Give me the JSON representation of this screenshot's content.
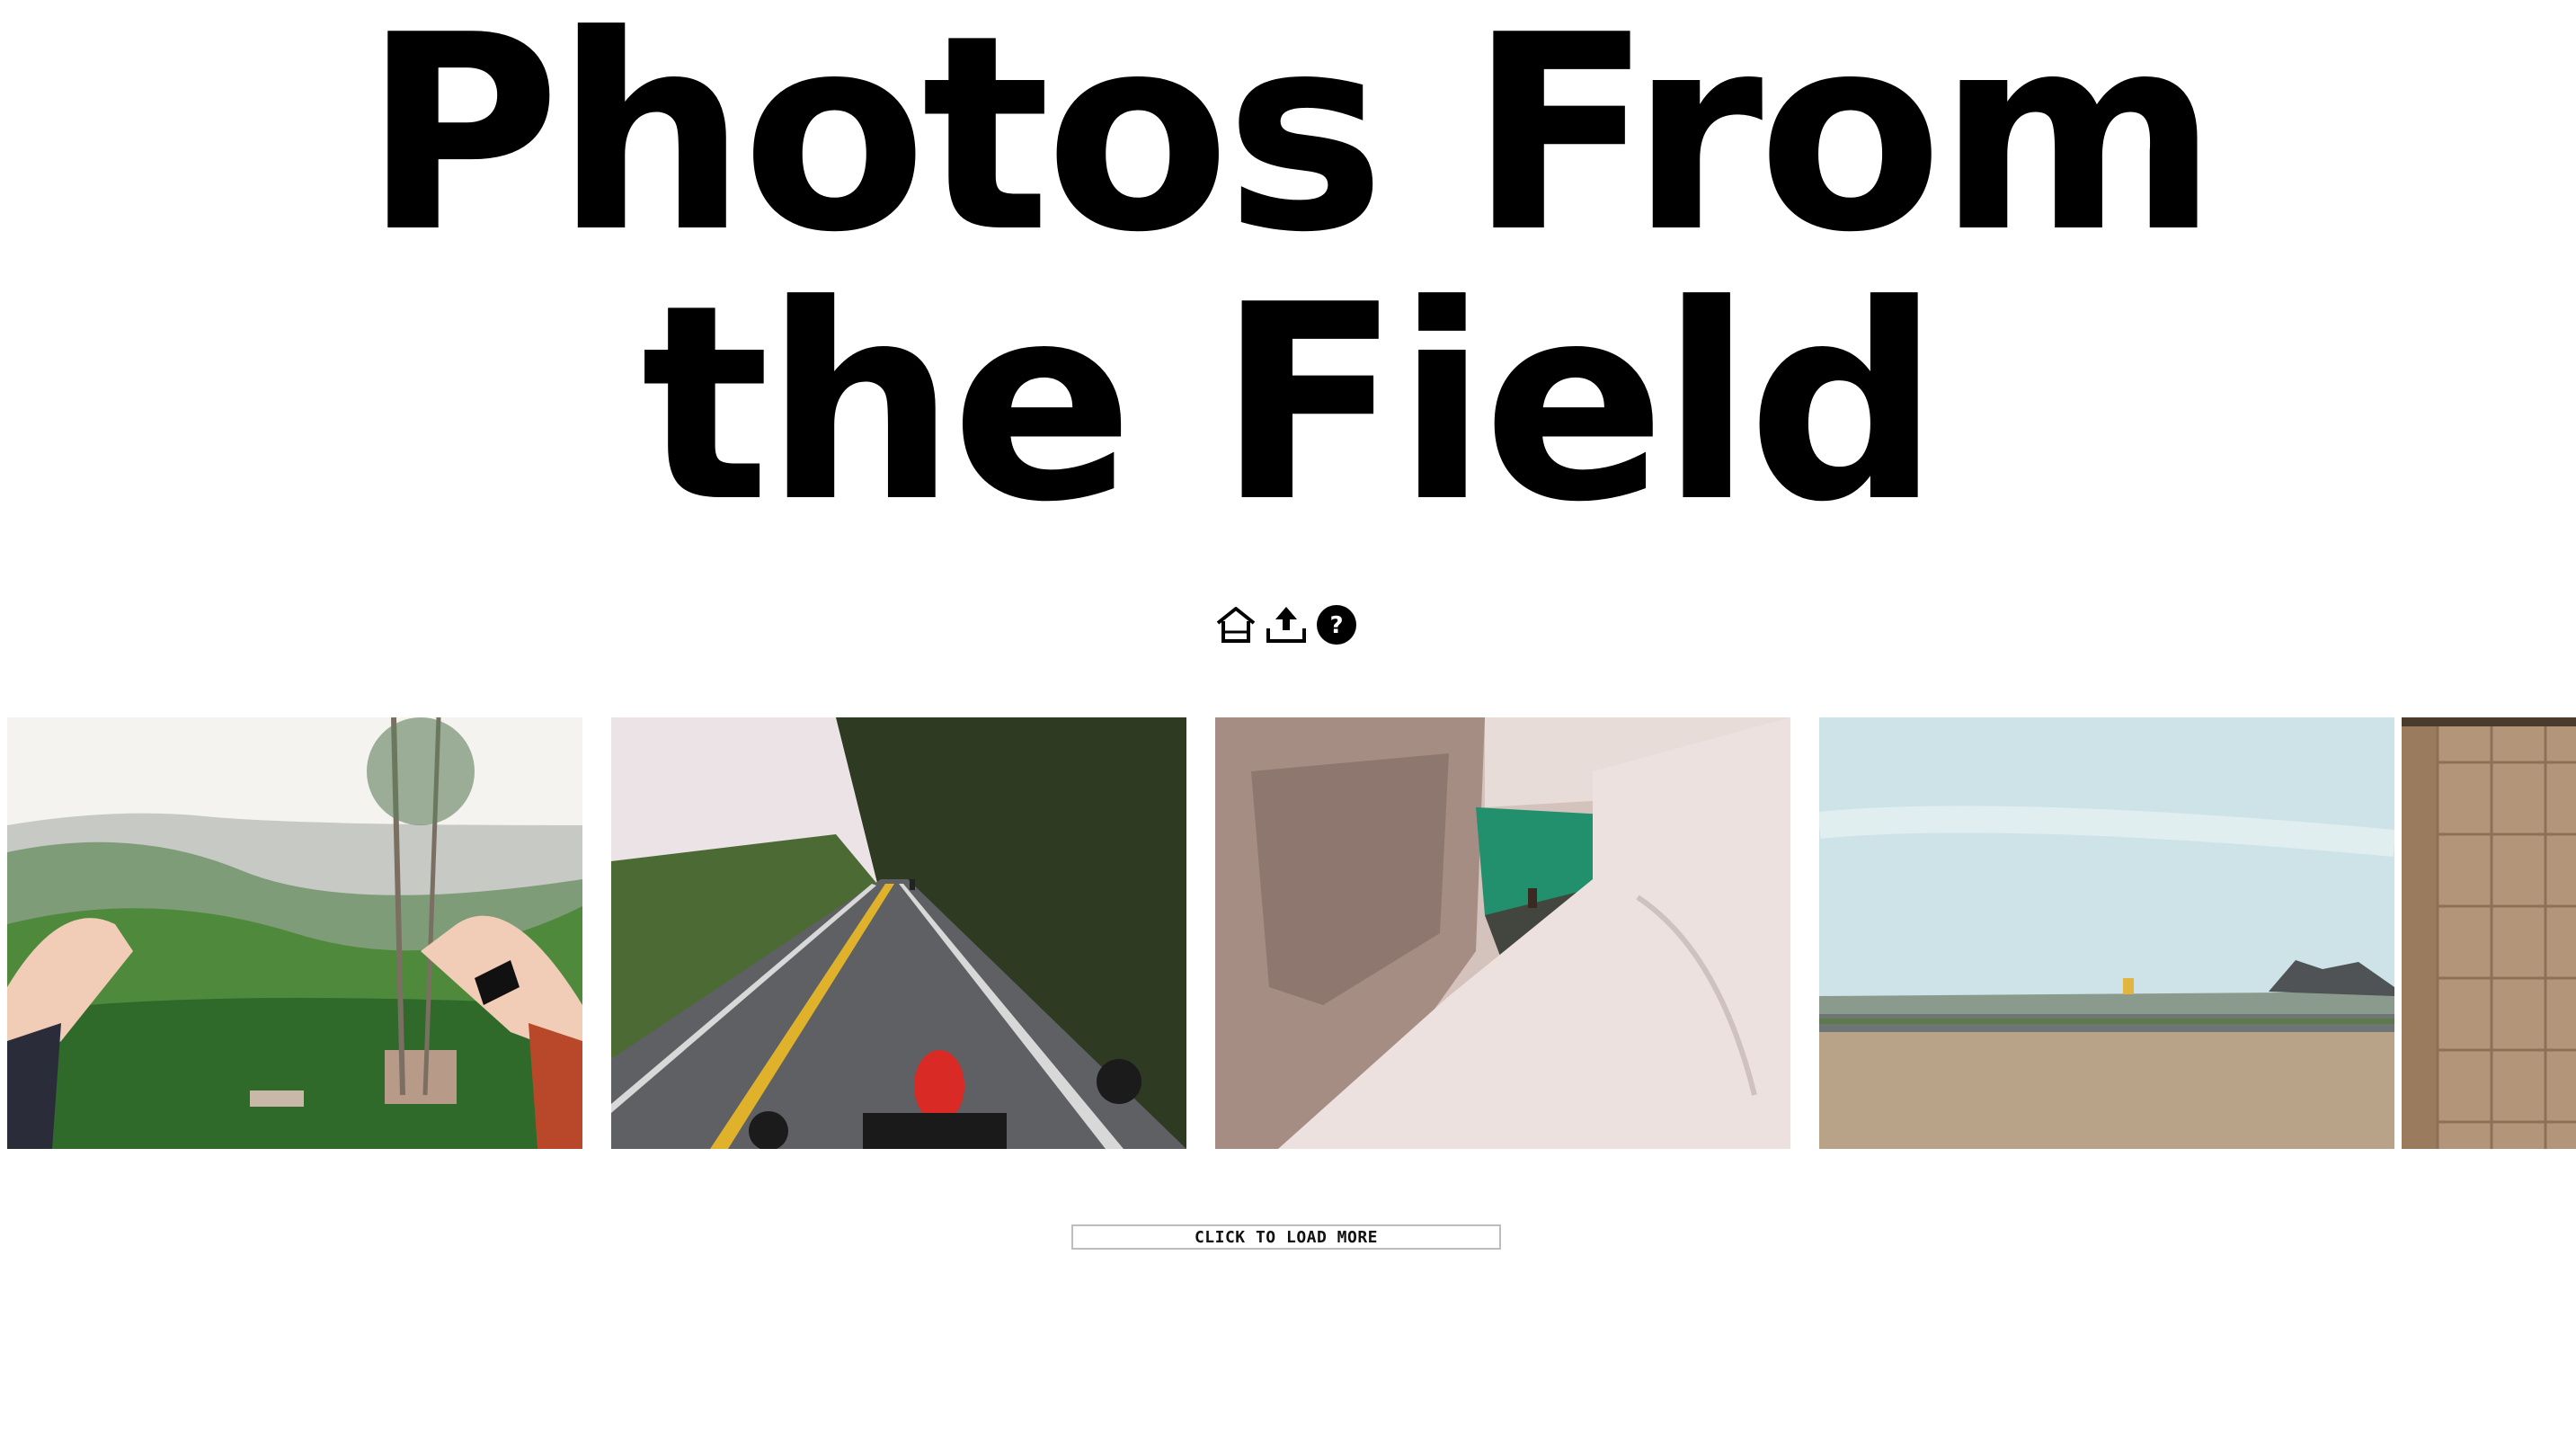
{
  "header": {
    "title_line1": "Photos From",
    "title_line2": "the Field"
  },
  "toolbar": {
    "icons": [
      {
        "name": "home-icon"
      },
      {
        "name": "upload-icon"
      },
      {
        "name": "help-icon",
        "glyph": "?"
      }
    ]
  },
  "gallery": {
    "photos": [
      {
        "name": "mountain-valley-hands",
        "sky": "#f2f2ee",
        "ground": "#3f7a35"
      },
      {
        "name": "motorcycle-road",
        "sky": "#e9e2e4",
        "ground": "#5c5d60"
      },
      {
        "name": "rock-gorge-pool",
        "sky": "#d8c5bf",
        "ground": "#1d8a6c"
      },
      {
        "name": "desert-highway",
        "sky": "#c9e0e6",
        "ground": "#b59f85"
      },
      {
        "name": "tiled-wall",
        "sky": "#b89b7e",
        "ground": "#9a7d60"
      }
    ]
  },
  "actions": {
    "load_more_label": "CLICK TO LOAD MORE"
  }
}
